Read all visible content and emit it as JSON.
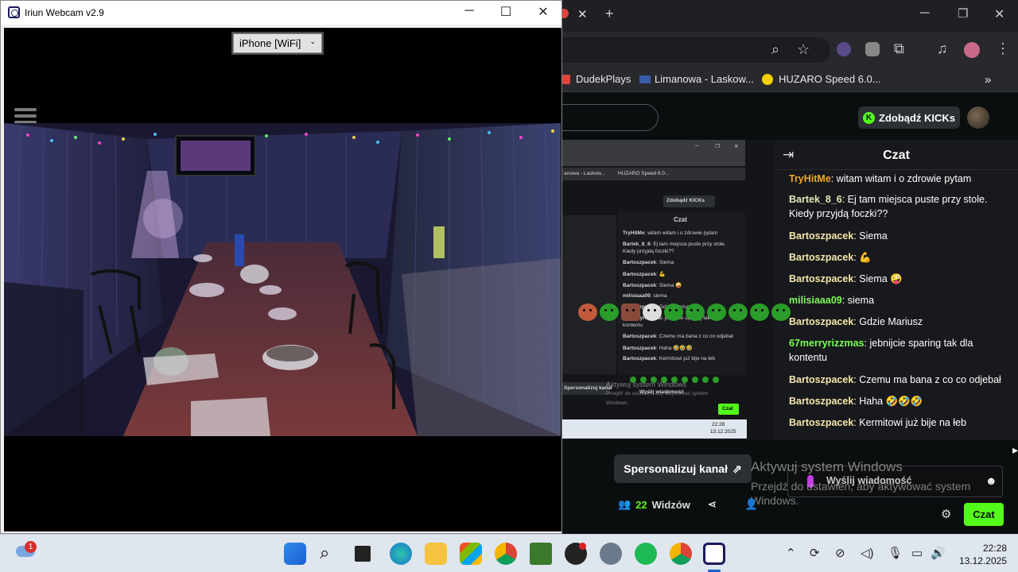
{
  "iriun": {
    "title": "Iriun Webcam v2.9",
    "camera_select": "iPhone [WiFi]"
  },
  "browser": {
    "bookmarks": [
      "DudekPlays",
      "Limanowa - Laskow...",
      "HUZARO Speed 6.0..."
    ],
    "kick_button": "Zdobądź KICKs",
    "nested": {
      "kick_button": "Zdobądź KICKs",
      "chat_title": "Czat",
      "bookmarks": [
        "anowa - Laskow...",
        "HUZARO Speed 6.0..."
      ],
      "messages": [
        {
          "user": "TryHitMe",
          "text": "witam witam i o zdrowie pytam"
        },
        {
          "user": "Bartek_8_6",
          "text": "Ej tam miejsca puste przy stole."
        },
        {
          "user": "",
          "text": "Kiedy przyjdą foczki??"
        },
        {
          "user": "Bartoszpacek",
          "text": "Siema"
        },
        {
          "user": "Bartoszpacek",
          "text": "💪"
        },
        {
          "user": "Bartoszpacek",
          "text": "Siema 🤪"
        },
        {
          "user": "milisiaaa09",
          "text": "siema"
        },
        {
          "user": "Bartoszpacek",
          "text": "Gdzie Mariusz"
        },
        {
          "user": "67merryrizzmas",
          "text": "jebnijcie sparing tak dla"
        },
        {
          "user": "",
          "text": "kontentu"
        },
        {
          "user": "Bartoszpacek",
          "text": "Czemu ma bana z co co odjebał"
        },
        {
          "user": "Bartoszpacek",
          "text": "Haha 🤣🤣🤣"
        },
        {
          "user": "Bartoszpacek",
          "text": "Kermitowi już bije na łeb"
        }
      ],
      "personalize": "Spersonalizuj kanał",
      "activate_1": "Aktywuj system Windows",
      "activate_2": "Przejdź do ustawień, aby aktywować system",
      "activate_3": "Windows.",
      "send_placeholder": "Wyślij wiadomość",
      "czat_button": "Czat",
      "clock_time": "22:28",
      "clock_date": "13.12.2025"
    },
    "chat": {
      "title": "Czat",
      "messages": [
        {
          "user": "TryHitMe",
          "color": "#f5a623",
          "text": "witam witam i o zdrowie pytam"
        },
        {
          "user": "Bartek_8_6",
          "color": "#e6e6b8",
          "text": "Ej tam miejsca puste przy stole. Kiedy przyjdą foczki??"
        },
        {
          "user": "Bartoszpacek",
          "color": "#f5e6a8",
          "text": "Siema"
        },
        {
          "user": "Bartoszpacek",
          "color": "#f5e6a8",
          "text": "💪"
        },
        {
          "user": "Bartoszpacek",
          "color": "#f5e6a8",
          "text": "Siema 🤪"
        },
        {
          "user": "milisiaaa09",
          "color": "#7cfc5a",
          "text": "siema"
        },
        {
          "user": "Bartoszpacek",
          "color": "#f5e6a8",
          "text": "Gdzie Mariusz"
        },
        {
          "user": "67merryrizzmas",
          "color": "#7cfc5a",
          "text": "jebnijcie sparing tak dla kontentu"
        },
        {
          "user": "Bartoszpacek",
          "color": "#f5e6a8",
          "text": "Czemu ma bana z co co odjebał"
        },
        {
          "user": "Bartoszpacek",
          "color": "#f5e6a8",
          "text": "Haha 🤣🤣🤣"
        },
        {
          "user": "Bartoszpacek",
          "color": "#f5e6a8",
          "text": "Kermitowi już bije na łeb"
        }
      ]
    },
    "personalize": "Spersonalizuj kanał",
    "send_placeholder": "Wyślij wiadomość",
    "viewers_count": "22",
    "viewers_label": "Widzów",
    "czat_button": "Czat",
    "activate_line1": "Aktywuj system Windows",
    "activate_line2": "Przejdź do ustawień, aby aktywować system",
    "activate_line3": "Windows."
  },
  "taskbar": {
    "time": "22:28",
    "date": "13.12.2025",
    "weather_badge": "1"
  },
  "colors": {
    "kick_green": "#53fc18",
    "chat_bg": "#18191c",
    "taskbar": "#dfe6ee"
  }
}
